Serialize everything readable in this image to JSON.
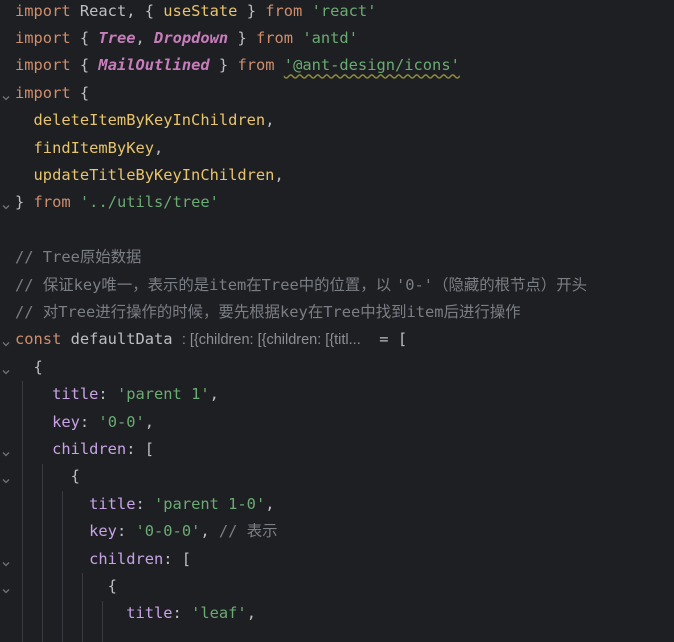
{
  "editor": {
    "lines": [
      {
        "tokens": [
          {
            "t": "import",
            "c": "kw"
          },
          {
            "t": " React, { ",
            "c": "id"
          },
          {
            "t": "useState",
            "c": "hl"
          },
          {
            "t": " } ",
            "c": "id"
          },
          {
            "t": "from",
            "c": "kw"
          },
          {
            "t": " ",
            "c": "id"
          },
          {
            "t": "'react'",
            "c": "str"
          }
        ]
      },
      {
        "tokens": [
          {
            "t": "import",
            "c": "kw"
          },
          {
            "t": " { ",
            "c": "id"
          },
          {
            "t": "Tree",
            "c": "it"
          },
          {
            "t": ", ",
            "c": "id"
          },
          {
            "t": "Dropdown",
            "c": "it"
          },
          {
            "t": " } ",
            "c": "id"
          },
          {
            "t": "from",
            "c": "kw"
          },
          {
            "t": " ",
            "c": "id"
          },
          {
            "t": "'antd'",
            "c": "str"
          }
        ]
      },
      {
        "tokens": [
          {
            "t": "import",
            "c": "kw"
          },
          {
            "t": " { ",
            "c": "id"
          },
          {
            "t": "MailOutlined",
            "c": "it"
          },
          {
            "t": " } ",
            "c": "id"
          },
          {
            "t": "from",
            "c": "kw"
          },
          {
            "t": " ",
            "c": "id"
          },
          {
            "t": "'@ant-design/icons'",
            "c": "str pkg"
          }
        ]
      },
      {
        "tokens": [
          {
            "t": "import",
            "c": "kw"
          },
          {
            "t": " {",
            "c": "id"
          }
        ]
      },
      {
        "tokens": [
          {
            "t": "  deleteItemByKeyInChildren",
            "c": "hl"
          },
          {
            "t": ",",
            "c": "id"
          }
        ]
      },
      {
        "tokens": [
          {
            "t": "  findItemByKey",
            "c": "hl"
          },
          {
            "t": ",",
            "c": "id"
          }
        ]
      },
      {
        "tokens": [
          {
            "t": "  updateTitleByKeyInChildren",
            "c": "hl"
          },
          {
            "t": ",",
            "c": "id"
          }
        ]
      },
      {
        "tokens": [
          {
            "t": "} ",
            "c": "id"
          },
          {
            "t": "from",
            "c": "kw"
          },
          {
            "t": " ",
            "c": "id"
          },
          {
            "t": "'../utils/tree'",
            "c": "str"
          }
        ]
      },
      {
        "tokens": []
      },
      {
        "tokens": [
          {
            "t": "// Tree",
            "c": "comment"
          },
          {
            "t": "原始数据",
            "c": "comment cjk"
          }
        ]
      },
      {
        "tokens": [
          {
            "t": "// ",
            "c": "comment"
          },
          {
            "t": "保证",
            "c": "comment cjk"
          },
          {
            "t": "key",
            "c": "comment"
          },
          {
            "t": "唯一，表示的是",
            "c": "comment cjk"
          },
          {
            "t": "item",
            "c": "comment"
          },
          {
            "t": "在",
            "c": "comment cjk"
          },
          {
            "t": "Tree",
            "c": "comment"
          },
          {
            "t": "中的位置，以 ",
            "c": "comment cjk"
          },
          {
            "t": "'0-'",
            "c": "comment"
          },
          {
            "t": "（隐藏的根节点）开头",
            "c": "comment cjk"
          }
        ]
      },
      {
        "tokens": [
          {
            "t": "// ",
            "c": "comment"
          },
          {
            "t": "对",
            "c": "comment cjk"
          },
          {
            "t": "Tree",
            "c": "comment"
          },
          {
            "t": "进行操作的时候，要先根据",
            "c": "comment cjk"
          },
          {
            "t": "key",
            "c": "comment"
          },
          {
            "t": "在",
            "c": "comment cjk"
          },
          {
            "t": "Tree",
            "c": "comment"
          },
          {
            "t": "中找到",
            "c": "comment cjk"
          },
          {
            "t": "item",
            "c": "comment"
          },
          {
            "t": "后进行操作",
            "c": "comment cjk"
          }
        ]
      },
      {
        "tokens": [
          {
            "t": "const",
            "c": "kw"
          },
          {
            "t": " defaultData ",
            "c": "id"
          },
          {
            "t": ": [{children: [{children: [{titl...",
            "c": "hint"
          },
          {
            "t": "  = [",
            "c": "id"
          }
        ]
      },
      {
        "tokens": [
          {
            "t": "  {",
            "c": "id"
          }
        ]
      },
      {
        "tokens": [
          {
            "t": "    title",
            "c": "propkey"
          },
          {
            "t": ": ",
            "c": "id"
          },
          {
            "t": "'parent 1'",
            "c": "str"
          },
          {
            "t": ",",
            "c": "id"
          }
        ]
      },
      {
        "tokens": [
          {
            "t": "    key",
            "c": "propkey"
          },
          {
            "t": ": ",
            "c": "id"
          },
          {
            "t": "'0-0'",
            "c": "str"
          },
          {
            "t": ",",
            "c": "id"
          }
        ]
      },
      {
        "tokens": [
          {
            "t": "    children",
            "c": "propkey"
          },
          {
            "t": ": [",
            "c": "id"
          }
        ]
      },
      {
        "tokens": [
          {
            "t": "      {",
            "c": "id"
          }
        ]
      },
      {
        "tokens": [
          {
            "t": "        title",
            "c": "propkey"
          },
          {
            "t": ": ",
            "c": "id"
          },
          {
            "t": "'parent 1-0'",
            "c": "str"
          },
          {
            "t": ",",
            "c": "id"
          }
        ]
      },
      {
        "tokens": [
          {
            "t": "        key",
            "c": "propkey"
          },
          {
            "t": ": ",
            "c": "id"
          },
          {
            "t": "'0-0-0'",
            "c": "str"
          },
          {
            "t": ", ",
            "c": "id"
          },
          {
            "t": "// ",
            "c": "comment"
          },
          {
            "t": "表示",
            "c": "comment cjk"
          }
        ]
      },
      {
        "tokens": [
          {
            "t": "        children",
            "c": "propkey"
          },
          {
            "t": ": [",
            "c": "id"
          }
        ]
      },
      {
        "tokens": [
          {
            "t": "          {",
            "c": "id"
          }
        ]
      },
      {
        "tokens": [
          {
            "t": "            title",
            "c": "propkey"
          },
          {
            "t": ": ",
            "c": "id"
          },
          {
            "t": "'leaf'",
            "c": "str"
          },
          {
            "t": ",",
            "c": "id"
          }
        ]
      }
    ],
    "fold_marker_lines": [
      3,
      7,
      12,
      13,
      16,
      17,
      20,
      21
    ],
    "colors": {
      "background": "#1e1f22",
      "keyword": "#cf8e6d",
      "string": "#6aab73",
      "identifier": "#bcbec4",
      "highlighted_identifier": "#e8c46b",
      "italic_identifier": "#c77dbb",
      "comment": "#7a7e85",
      "property": "#c7a3e6"
    }
  }
}
